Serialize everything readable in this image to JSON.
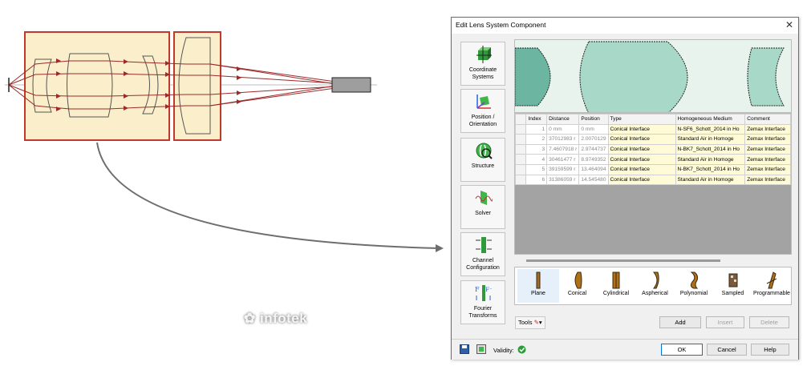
{
  "dialog": {
    "title": "Edit Lens System Component",
    "close_glyph": "✕"
  },
  "sidebar": [
    {
      "label": "Coordinate Systems",
      "icon": "coordinate-systems-icon"
    },
    {
      "label": "Position / Orientation",
      "icon": "position-orientation-icon"
    },
    {
      "label": "Structure",
      "icon": "structure-icon"
    },
    {
      "label": "Solver",
      "icon": "solver-icon"
    },
    {
      "label": "Channel Configuration",
      "icon": "channel-configuration-icon"
    },
    {
      "label": "Fourier Transforms",
      "icon": "fourier-transforms-icon"
    }
  ],
  "table": {
    "columns": [
      "Index",
      "Distance",
      "Position",
      "Type",
      "Homogeneous Medium",
      "Comment"
    ],
    "rows": [
      {
        "index": "1",
        "distance": "0 mm",
        "position": "0 mm",
        "type": "Conical Interface",
        "medium": "N-SF6_Schott_2014 in Ho",
        "comment": "Zemax Interface"
      },
      {
        "index": "2",
        "distance": "37012983 r",
        "position": "2.0070129",
        "type": "Conical Interface",
        "medium": "Standard Air in Homoge",
        "comment": "Zemax Interface"
      },
      {
        "index": "3",
        "distance": "7.4607918 r",
        "position": "2.9744737",
        "type": "Conical Interface",
        "medium": "N-BK7_Schott_2014 in Ho",
        "comment": "Zemax Interface"
      },
      {
        "index": "4",
        "distance": "30461477 r",
        "position": "8.9749352",
        "type": "Conical Interface",
        "medium": "Standard Air in Homoge",
        "comment": "Zemax Interface"
      },
      {
        "index": "5",
        "distance": "39159599 r",
        "position": "13.464094",
        "type": "Conical Interface",
        "medium": "N-BK7_Schott_2014 in Ho",
        "comment": "Zemax Interface"
      },
      {
        "index": "6",
        "distance": "31386059 r",
        "position": "14.545480",
        "type": "Conical Interface",
        "medium": "Standard Air in Homoge",
        "comment": "Zemax Interface"
      }
    ]
  },
  "palette": [
    {
      "label": "Plane",
      "icon": "plane-surface-icon",
      "selected": true
    },
    {
      "label": "Conical",
      "icon": "conical-surface-icon"
    },
    {
      "label": "Cylindrical",
      "icon": "cylindrical-surface-icon"
    },
    {
      "label": "Aspherical",
      "icon": "aspherical-surface-icon"
    },
    {
      "label": "Polynomial",
      "icon": "polynomial-surface-icon"
    },
    {
      "label": "Sampled",
      "icon": "sampled-surface-icon"
    },
    {
      "label": "Programmable",
      "icon": "programmable-surface-icon"
    }
  ],
  "buttons": {
    "tools": "Tools",
    "add": "Add",
    "insert": "Insert",
    "delete": "Delete",
    "ok": "OK",
    "cancel": "Cancel",
    "help": "Help"
  },
  "status": {
    "validity_label": "Validity:",
    "validity_state": "valid"
  },
  "watermark": "infotek",
  "colors": {
    "lens_fill": "#fbeecb",
    "lens_group_border": "#c0392b",
    "ray": "#9b2a2a",
    "preview_lens_dark": "#6cb5a0",
    "preview_lens_light": "#a8d8c8",
    "highlight_yellow": "#fffbd6"
  }
}
